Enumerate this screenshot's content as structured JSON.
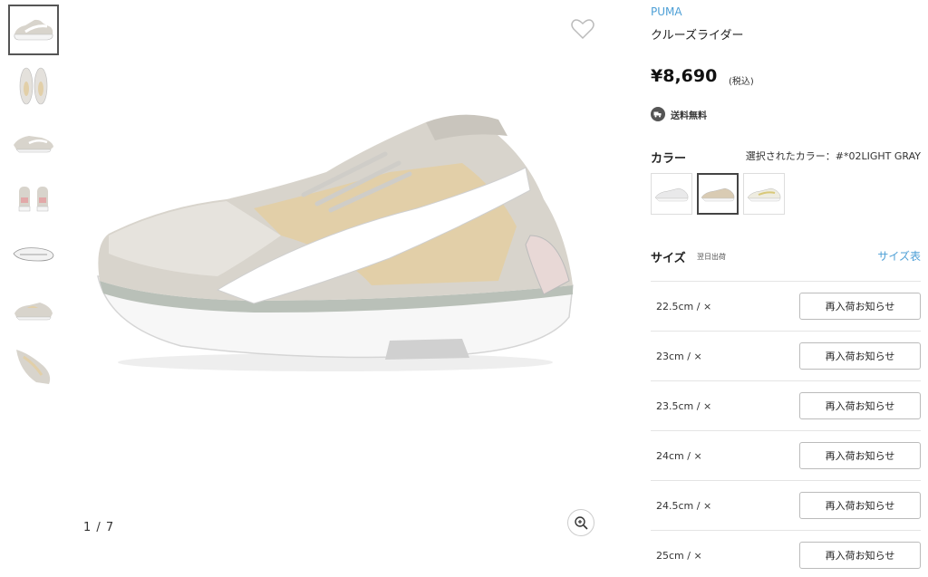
{
  "gallery": {
    "thumbnails": [
      {
        "name": "side-view",
        "active": true
      },
      {
        "name": "top-view",
        "active": false
      },
      {
        "name": "angle-view",
        "active": false
      },
      {
        "name": "back-view",
        "active": false
      },
      {
        "name": "sole-view",
        "active": false
      },
      {
        "name": "inner-view",
        "active": false
      },
      {
        "name": "detail-view",
        "active": false
      }
    ],
    "pager": "1 / 7"
  },
  "product": {
    "brand": "PUMA",
    "name": "クルーズライダー",
    "price": "¥8,690",
    "tax_note": "(税込)",
    "shipping": "送料無料"
  },
  "color": {
    "label": "カラー",
    "selected_text": "選択されたカラー：#*02LIGHT GRAY",
    "swatch_colors": [
      "#e9e9ea",
      "#d9cbb3",
      "#eeece0"
    ]
  },
  "size": {
    "label": "サイズ",
    "sub": "翌日出荷",
    "chart_link": "サイズ表",
    "rows": [
      {
        "size": "22.5cm / ×",
        "button": "再入荷お知らせ"
      },
      {
        "size": "23cm / ×",
        "button": "再入荷お知らせ"
      },
      {
        "size": "23.5cm / ×",
        "button": "再入荷お知らせ"
      },
      {
        "size": "24cm / ×",
        "button": "再入荷お知らせ"
      },
      {
        "size": "24.5cm / ×",
        "button": "再入荷お知らせ"
      },
      {
        "size": "25cm / ×",
        "button": "再入荷お知らせ"
      }
    ]
  },
  "colors": {
    "accent_link": "#4d9fd6",
    "shoe_upper": "#d8d4cc",
    "shoe_tan": "#e2cfa8",
    "shoe_sole": "#f6f6f6",
    "shoe_midline": "#b9c0b8"
  }
}
